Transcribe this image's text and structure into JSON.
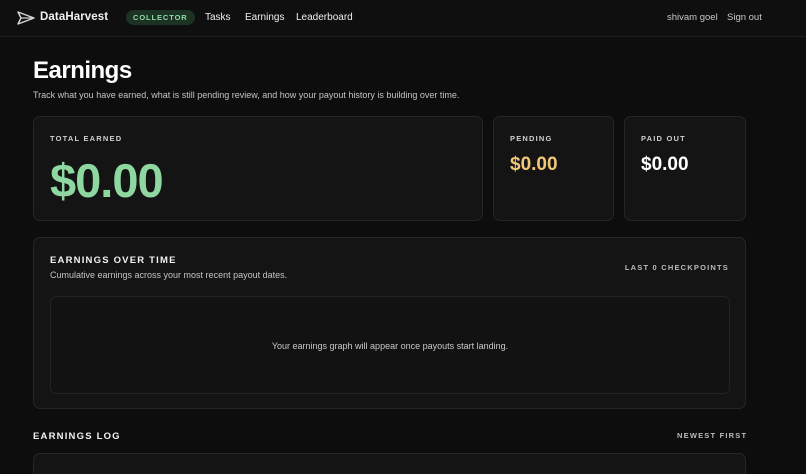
{
  "app": {
    "brand": "DataHarvest",
    "role_badge": "COLLECTOR",
    "logo_icon": "paper-plane-icon"
  },
  "nav": {
    "items": [
      {
        "label": "Tasks"
      },
      {
        "label": "Earnings"
      },
      {
        "label": "Leaderboard"
      }
    ]
  },
  "user": {
    "name": "shivam goel",
    "sign_out_label": "Sign out"
  },
  "page": {
    "title": "Earnings",
    "subtitle": "Track what you have earned, what is still pending review, and how your payout history is building over time."
  },
  "stats": {
    "total": {
      "label": "TOTAL EARNED",
      "value": "$0.00"
    },
    "pending": {
      "label": "PENDING",
      "value": "$0.00"
    },
    "paid": {
      "label": "PAID OUT",
      "value": "$0.00"
    }
  },
  "chart": {
    "title": "EARNINGS OVER TIME",
    "description": "Cumulative earnings across your most recent payout dates.",
    "range_label": "LAST 0 CHECKPOINTS",
    "empty_message": "Your earnings graph will appear once payouts start landing."
  },
  "log": {
    "title": "EARNINGS LOG",
    "sort_label": "NEWEST FIRST"
  },
  "colors": {
    "background": "#0d0d0d",
    "card": "#141414",
    "accent_green": "#8ed7a0",
    "pending_yellow": "#f2c877",
    "badge_bg": "#1c3324"
  }
}
